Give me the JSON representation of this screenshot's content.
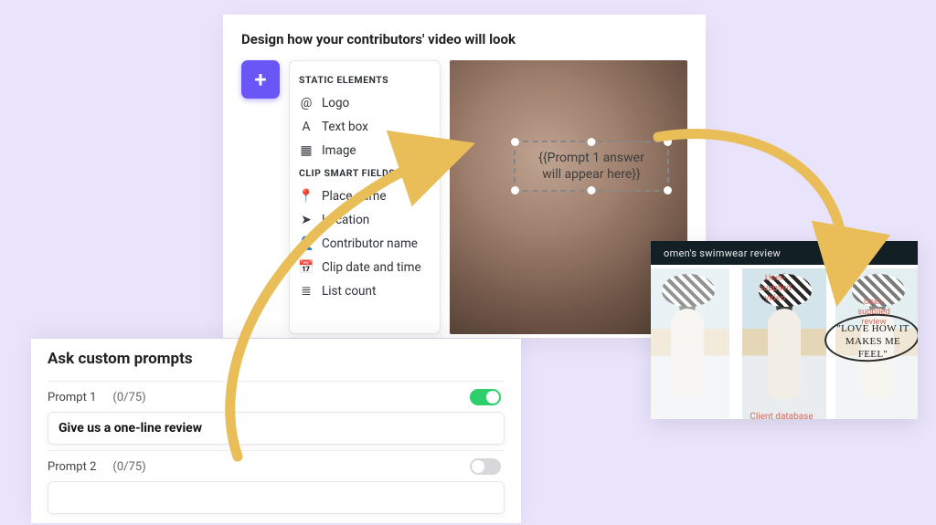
{
  "designer": {
    "title": "Design how your contributors' video will look",
    "static_header": "STATIC ELEMENTS",
    "static_items": [
      {
        "icon": "@",
        "label": "Logo",
        "name": "logo"
      },
      {
        "icon": "A",
        "label": "Text box",
        "name": "text-box"
      },
      {
        "icon": "▦",
        "label": "Image",
        "name": "image"
      }
    ],
    "smart_header": "CLIP SMART FIELDS",
    "smart_items": [
      {
        "icon": "📍",
        "label": "Place name",
        "name": "place-name"
      },
      {
        "icon": "➤",
        "label": "Location",
        "name": "location"
      },
      {
        "icon": "👤",
        "label": "Contributor name",
        "name": "contributor-name"
      },
      {
        "icon": "📅",
        "label": "Clip date and time",
        "name": "clip-date-time"
      },
      {
        "icon": "≣",
        "label": "List count",
        "name": "list-count"
      }
    ],
    "placeholder_line1": "{{Prompt 1 answer",
    "placeholder_line2": "will appear here}}"
  },
  "prompts": {
    "title": "Ask custom prompts",
    "rows": [
      {
        "label": "Prompt 1",
        "counter": "(0/75)",
        "enabled": true,
        "value": "Give us a one-line review"
      },
      {
        "label": "Prompt 2",
        "counter": "(0/75)",
        "enabled": false,
        "value": ""
      }
    ]
  },
  "result": {
    "banner": "omen's swimwear review",
    "tag_video": "User-\nsupplied\nvideo",
    "tag_review": "User-\nsupplied\nreview",
    "tag_db": "Client database",
    "review_text": "\"LOVE HOW IT MAKES ME FEEL\""
  }
}
